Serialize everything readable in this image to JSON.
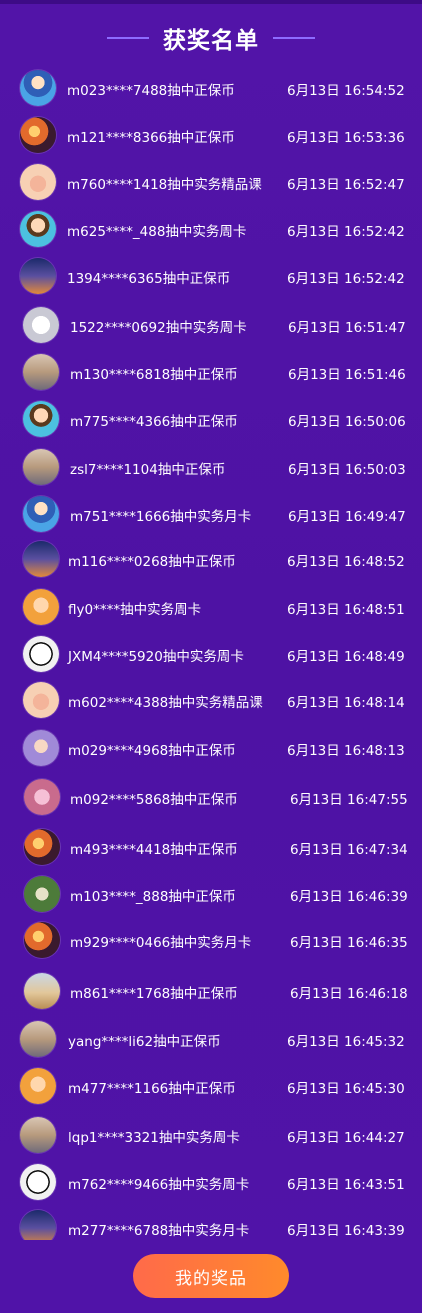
{
  "header": {
    "title": "获奖名单"
  },
  "winners": [
    {
      "avatar": "avatar-suit-icon",
      "avatar_style": "av-blue",
      "name": "m023****7488抽中正保币",
      "time": "6月13日 16:54:52"
    },
    {
      "avatar": "avatar-sunset-icon",
      "avatar_style": "av-sunset",
      "name": "m121****8366抽中正保币",
      "time": "6月13日 16:53:36"
    },
    {
      "avatar": "avatar-cat-icon",
      "avatar_style": "av-cat",
      "name": "m760****1418抽中实务精品课",
      "time": "6月13日 16:52:47"
    },
    {
      "avatar": "avatar-boy-icon",
      "avatar_style": "av-boy",
      "name": "m625****_488抽中实务周卡",
      "time": "6月13日 16:52:42"
    },
    {
      "avatar": "avatar-city-icon",
      "avatar_style": "av-city",
      "name": "1394****6365抽中正保币",
      "time": "6月13日 16:52:42"
    },
    {
      "avatar": "avatar-hand-icon",
      "avatar_style": "av-hand",
      "name": "1522****0692抽中实务周卡",
      "time": "6月13日 16:51:47"
    },
    {
      "avatar": "avatar-bridge-icon",
      "avatar_style": "av-bridge",
      "name": "m130****6818抽中正保币",
      "time": "6月13日 16:51:46"
    },
    {
      "avatar": "avatar-boy-icon",
      "avatar_style": "av-boy",
      "name": "m775****4366抽中正保币",
      "time": "6月13日 16:50:06"
    },
    {
      "avatar": "avatar-bridge-icon",
      "avatar_style": "av-bridge",
      "name": "zsl7****1104抽中正保币",
      "time": "6月13日 16:50:03"
    },
    {
      "avatar": "avatar-suit-icon",
      "avatar_style": "av-blue",
      "name": "m751****1666抽中实务月卡",
      "time": "6月13日 16:49:47"
    },
    {
      "avatar": "avatar-city-icon",
      "avatar_style": "av-city",
      "name": "m116****0268抽中正保币",
      "time": "6月13日 16:48:52"
    },
    {
      "avatar": "avatar-kid-icon",
      "avatar_style": "av-kid",
      "name": "fly0****抽中实务周卡",
      "time": "6月13日 16:48:51"
    },
    {
      "avatar": "avatar-panda-icon",
      "avatar_style": "av-panda",
      "name": "JXM4****5920抽中实务周卡",
      "time": "6月13日 16:48:49"
    },
    {
      "avatar": "avatar-cat-icon",
      "avatar_style": "av-cat",
      "name": "m602****4388抽中实务精品课",
      "time": "6月13日 16:48:14"
    },
    {
      "avatar": "avatar-girl-icon",
      "avatar_style": "av-girl",
      "name": "m029****4968抽中正保币",
      "time": "6月13日 16:48:13"
    },
    {
      "avatar": "avatar-pink-icon",
      "avatar_style": "av-pink",
      "name": "m092****5868抽中正保币",
      "time": "6月13日 16:47:55"
    },
    {
      "avatar": "avatar-sunset-icon",
      "avatar_style": "av-sunset",
      "name": "m493****4418抽中正保币",
      "time": "6月13日 16:47:34"
    },
    {
      "avatar": "avatar-green-icon",
      "avatar_style": "av-green",
      "name": "m103****_888抽中正保币",
      "time": "6月13日 16:46:39"
    },
    {
      "avatar": "avatar-sunset-icon",
      "avatar_style": "av-sunset",
      "name": "m929****0466抽中实务月卡",
      "time": "6月13日 16:46:35"
    },
    {
      "avatar": "avatar-desert-icon",
      "avatar_style": "av-desert",
      "name": "m861****1768抽中正保币",
      "time": "6月13日 16:46:18"
    },
    {
      "avatar": "avatar-bridge-icon",
      "avatar_style": "av-bridge",
      "name": "yang****li62抽中正保币",
      "time": "6月13日 16:45:32"
    },
    {
      "avatar": "avatar-kid-icon",
      "avatar_style": "av-kid",
      "name": "m477****1166抽中正保币",
      "time": "6月13日 16:45:30"
    },
    {
      "avatar": "avatar-bridge-icon",
      "avatar_style": "av-bridge",
      "name": "lqp1****3321抽中实务周卡",
      "time": "6月13日 16:44:27"
    },
    {
      "avatar": "avatar-panda-icon",
      "avatar_style": "av-panda",
      "name": "m762****9466抽中实务周卡",
      "time": "6月13日 16:43:51"
    },
    {
      "avatar": "avatar-city-icon",
      "avatar_style": "av-city",
      "name": "m277****6788抽中实务月卡",
      "time": "6月13日 16:43:39"
    }
  ],
  "footer": {
    "button_label": "我的奖品"
  },
  "colors": {
    "background": "#4f12a6",
    "button_start": "#ff6a4a",
    "button_end": "#ff8a2b",
    "divider": "#8d6bff"
  }
}
